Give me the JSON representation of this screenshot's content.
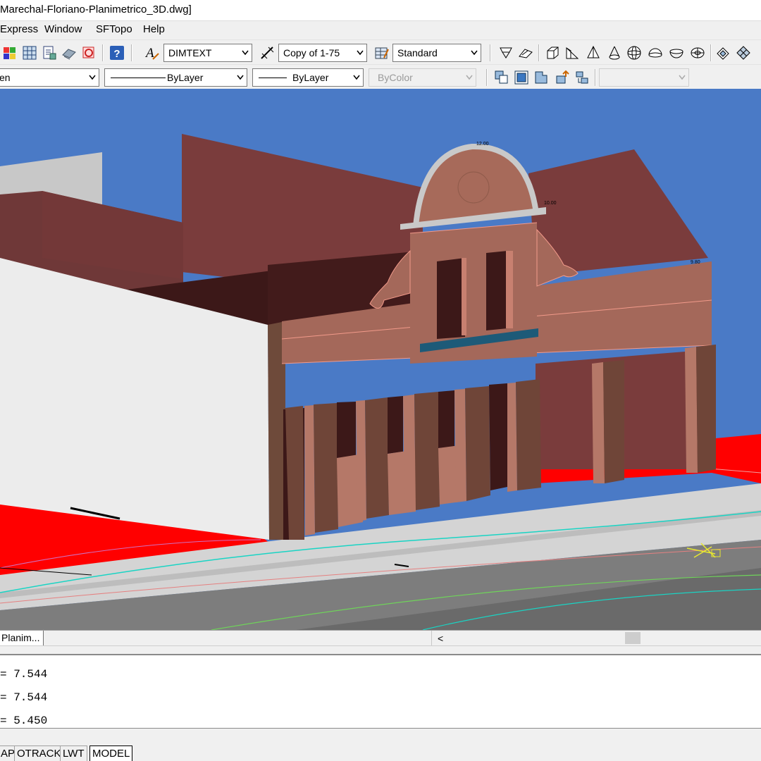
{
  "window": {
    "title": "Marechal-Floriano-Planimetrico_3D.dwg]"
  },
  "menu": {
    "items": [
      "Express",
      "Window",
      "SFTopo",
      "Help"
    ]
  },
  "styles_toolbar": {
    "text_style": "DIMTEXT",
    "dim_style": "Copy of 1-75",
    "table_style": "Standard"
  },
  "properties_toolbar": {
    "layer_partial": "en",
    "linetype": "ByLayer",
    "lineweight": "ByLayer",
    "plot_style": "ByColor",
    "extra": ""
  },
  "layout_tab": {
    "label": "Planim..."
  },
  "command_history": [
    "= 7.544",
    "= 7.544",
    "= 5.450"
  ],
  "status_bar": {
    "buttons": [
      "AP",
      "OTRACK",
      "LWT",
      "MODEL"
    ],
    "active": "MODEL"
  },
  "colors": {
    "viewport_bg": "#4a7ac6",
    "building_facade": "#a4685a",
    "roof_walls": "#763c3c",
    "ground_red": "#ff0000",
    "road": "#7a7a7a",
    "sidewalk": "#d3d3d3"
  }
}
